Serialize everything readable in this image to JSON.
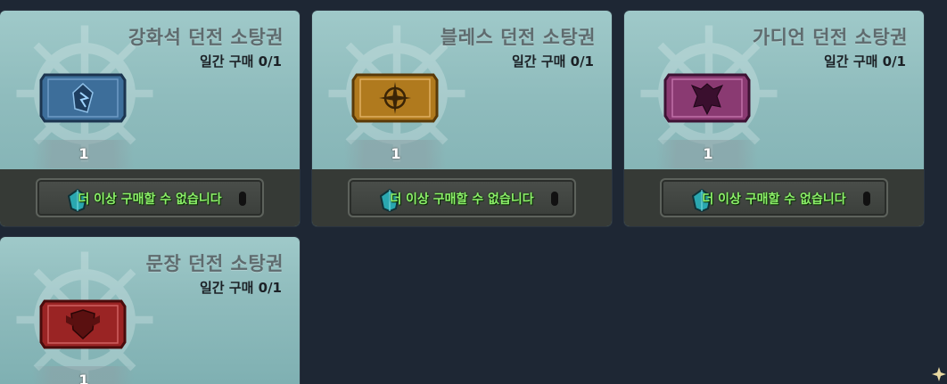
{
  "cards": [
    {
      "title": "강화석 던전 소탕권",
      "limit": "일간 구매 0/1",
      "quantity": "1",
      "button_label": "더 이상 구매할 수 없습니다",
      "ticket_icon": "enhancement-stone-icon",
      "ticket_color": "#3d6e9a"
    },
    {
      "title": "블레스 던전 소탕권",
      "limit": "일간 구매 0/1",
      "quantity": "1",
      "button_label": "더 이상 구매할 수 없습니다",
      "ticket_icon": "compass-icon",
      "ticket_color": "#b07a1e"
    },
    {
      "title": "가디언 던전 소탕권",
      "limit": "일간 구매 0/1",
      "quantity": "1",
      "button_label": "더 이상 구매할 수 없습니다",
      "ticket_icon": "dragon-icon",
      "ticket_color": "#8a3a72"
    },
    {
      "title": "문장 던전 소탕권",
      "limit": "일간 구매 0/1",
      "quantity": "1",
      "button_label": "",
      "ticket_icon": "crest-shield-icon",
      "ticket_color": "#9a2424"
    }
  ]
}
